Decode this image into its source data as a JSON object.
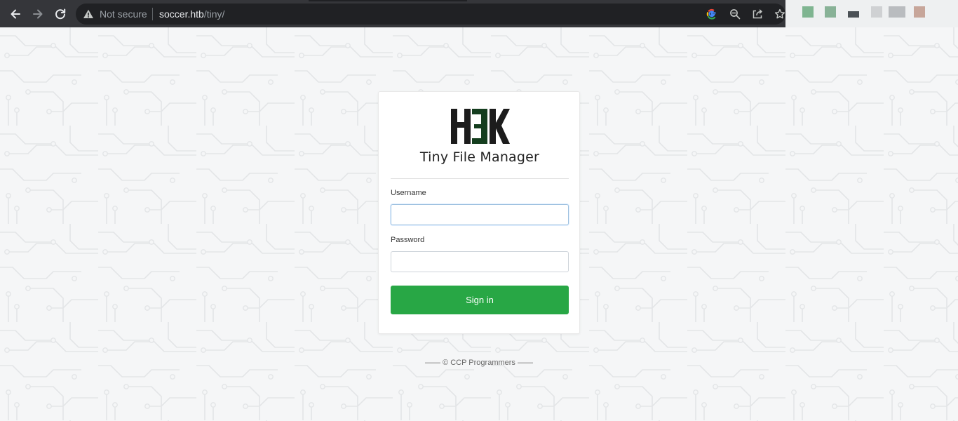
{
  "browser": {
    "security_label": "Not secure",
    "url_host": "soccer.htb",
    "url_path": "/tiny/"
  },
  "app": {
    "logo_text": "H3K",
    "title": "Tiny File Manager"
  },
  "login_form": {
    "username_label": "Username",
    "username_value": "",
    "password_label": "Password",
    "password_value": "",
    "signin_label": "Sign in"
  },
  "footer": {
    "text": "—— © CCP Programmers ——"
  },
  "colors": {
    "signin_button": "#28a745",
    "logo_dark": "#1c1c1c",
    "logo_green": "#143d1e",
    "chrome_bar": "#35363a"
  }
}
